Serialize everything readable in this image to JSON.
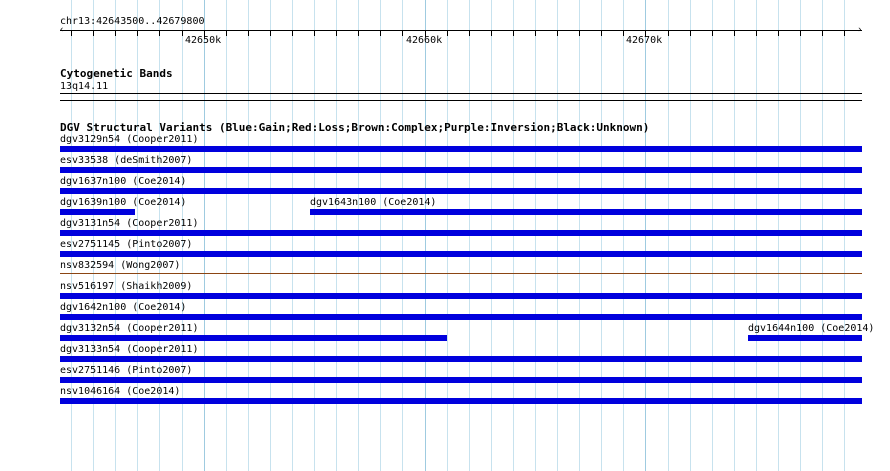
{
  "view": {
    "chrom": "chr13",
    "start": 42643500,
    "end": 42679800,
    "location_label": "chr13:42643500..42679800"
  },
  "ruler": {
    "labels": [
      "42650k",
      "42660k",
      "42670k"
    ],
    "label_positions": [
      42650000,
      42660000,
      42670000
    ]
  },
  "cytoband": {
    "title": "Cytogenetic Bands",
    "band": "13q14.11"
  },
  "dgv": {
    "title": "DGV Structural Variants (Blue:Gain;Red:Loss;Brown:Complex;Purple:Inversion;Black:Unknown)",
    "colors": {
      "gain": "#0000dd",
      "loss": "#dd0000",
      "complex": "#8b4513",
      "inversion": "#800080",
      "unknown": "#000000"
    },
    "rows": [
      {
        "features": [
          {
            "label": "dgv3129n54 (Cooper2011)",
            "start": 42643500,
            "end": 42679800,
            "type": "gain"
          }
        ]
      },
      {
        "features": [
          {
            "label": "esv33538 (deSmith2007)",
            "start": 42643500,
            "end": 42679800,
            "type": "gain"
          }
        ]
      },
      {
        "features": [
          {
            "label": "dgv1637n100 (Coe2014)",
            "start": 42643500,
            "end": 42679800,
            "type": "gain"
          }
        ]
      },
      {
        "features": [
          {
            "label": "dgv1639n100 (Coe2014)",
            "start": 42643500,
            "end": 42646900,
            "type": "gain"
          },
          {
            "label": "dgv1643n100 (Coe2014)",
            "start": 42654800,
            "end": 42679800,
            "type": "gain"
          }
        ]
      },
      {
        "features": [
          {
            "label": "dgv3131n54 (Cooper2011)",
            "start": 42643500,
            "end": 42679800,
            "type": "gain"
          }
        ]
      },
      {
        "features": [
          {
            "label": "esv2751145 (Pinto2007)",
            "start": 42643500,
            "end": 42679800,
            "type": "gain"
          }
        ]
      },
      {
        "features": [
          {
            "label": "nsv832594 (Wong2007)",
            "start": 42643500,
            "end": 42679800,
            "type": "complex"
          }
        ]
      },
      {
        "features": [
          {
            "label": "nsv516197 (Shaikh2009)",
            "start": 42643500,
            "end": 42679800,
            "type": "gain"
          }
        ]
      },
      {
        "features": [
          {
            "label": "dgv1642n100 (Coe2014)",
            "start": 42643500,
            "end": 42679800,
            "type": "gain"
          }
        ]
      },
      {
        "features": [
          {
            "label": "dgv3132n54 (Cooper2011)",
            "start": 42643500,
            "end": 42661000,
            "type": "gain"
          },
          {
            "label": "dgv1644n100 (Coe2014)",
            "start": 42674650,
            "end": 42679800,
            "type": "gain"
          }
        ]
      },
      {
        "features": [
          {
            "label": "dgv3133n54 (Cooper2011)",
            "start": 42643500,
            "end": 42679800,
            "type": "gain"
          }
        ]
      },
      {
        "features": [
          {
            "label": "esv2751146 (Pinto2007)",
            "start": 42643500,
            "end": 42679800,
            "type": "gain"
          }
        ]
      },
      {
        "features": [
          {
            "label": "nsv1046164 (Coe2014)",
            "start": 42643500,
            "end": 42679800,
            "type": "gain"
          }
        ]
      }
    ]
  }
}
